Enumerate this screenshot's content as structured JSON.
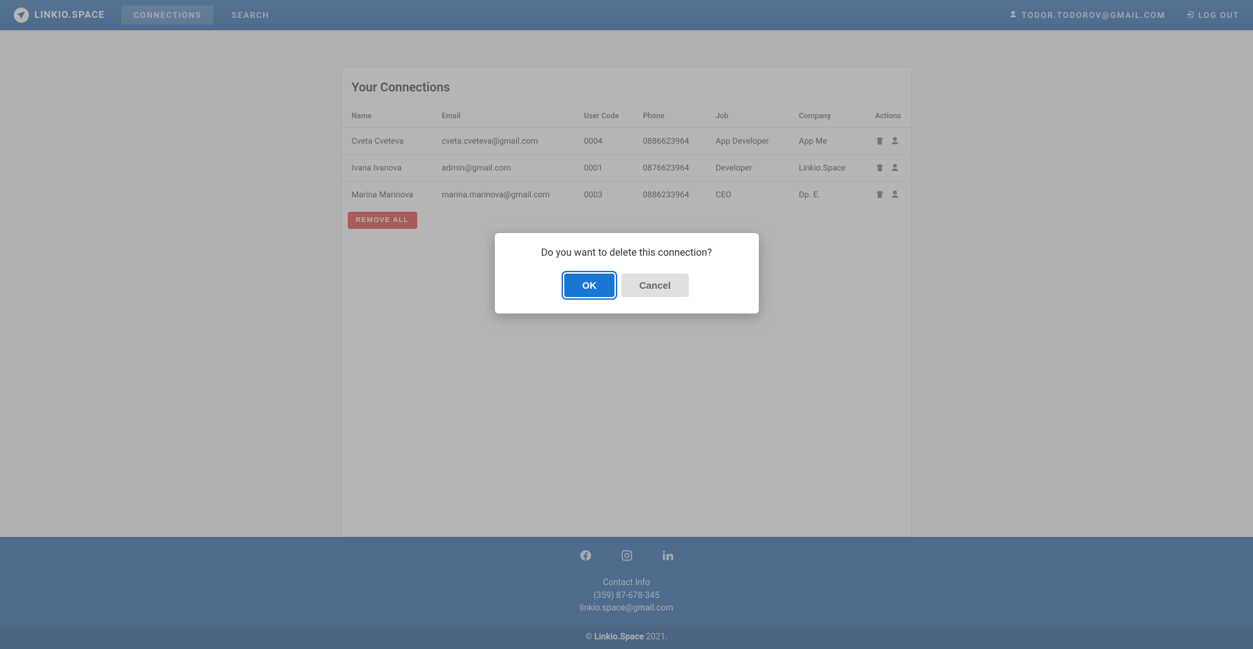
{
  "brand": {
    "name": "LINKIO.SPACE"
  },
  "nav": {
    "connections": "CONNECTIONS",
    "search": "SEARCH"
  },
  "header": {
    "user_email": "TODOR.TODOROV@GMAIL.COM",
    "logout": "LOG OUT"
  },
  "card": {
    "title": "Your Connections",
    "columns": {
      "name": "Name",
      "email": "Email",
      "user_code": "User Code",
      "phone": "Phone",
      "job": "Job",
      "company": "Company",
      "actions": "Actions"
    },
    "rows": [
      {
        "name": "Cveta Cveteva",
        "email": "cveta.cveteva@gmail.com",
        "user_code": "0004",
        "phone": "0886623964",
        "job": "App Developer",
        "company": "App Me"
      },
      {
        "name": "Ivana Ivanova",
        "email": "admin@gmail.com",
        "user_code": "0001",
        "phone": "0876623964",
        "job": "Developer",
        "company": "Linkio.Space"
      },
      {
        "name": "Marina Marinova",
        "email": "marina.marinova@gmail.com",
        "user_code": "0003",
        "phone": "0886233964",
        "job": "CEO",
        "company": "Dp. E."
      }
    ],
    "remove_all": "REMOVE ALL"
  },
  "dialog": {
    "message": "Do you want to delete this connection?",
    "ok": "OK",
    "cancel": "Cancel"
  },
  "footer": {
    "contact_label": "Contact Info",
    "phone": "(359) 87-678-345",
    "email": "linkio.space@gmail.com"
  },
  "copyright": {
    "symbol": "©",
    "brand": "Linkio.Space",
    "year": "2021."
  }
}
